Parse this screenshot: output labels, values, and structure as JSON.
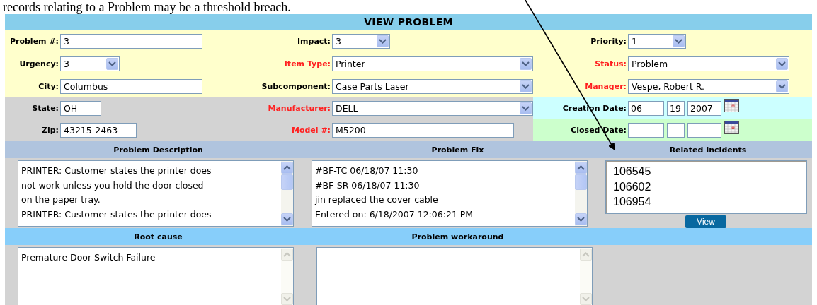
{
  "caption": "records relating to a Problem may be a threshold breach.",
  "title": "VIEW PROBLEM",
  "field_rows": [
    [
      {
        "label": "Problem #:",
        "required": false,
        "kind": "text",
        "value": "3"
      },
      {
        "label": "Impact:",
        "required": false,
        "kind": "select",
        "value": "3"
      },
      {
        "label": "Priority:",
        "required": false,
        "kind": "select",
        "value": "1"
      }
    ],
    [
      {
        "label": "Urgency:",
        "required": false,
        "kind": "select",
        "value": "3"
      },
      {
        "label": "Item Type:",
        "required": true,
        "kind": "select",
        "value": "Printer"
      },
      {
        "label": "Status:",
        "required": true,
        "kind": "select",
        "value": "Problem"
      }
    ],
    [
      {
        "label": "City:",
        "required": false,
        "kind": "text",
        "value": "Columbus"
      },
      {
        "label": "Subcomponent:",
        "required": false,
        "kind": "select",
        "value": "Case Parts Laser"
      },
      {
        "label": "Manager:",
        "required": true,
        "kind": "select",
        "value": "Vespe, Robert R."
      }
    ],
    [
      {
        "label": "State:",
        "required": false,
        "kind": "text",
        "value": "OH"
      },
      {
        "label": "Manufacturer:",
        "required": true,
        "kind": "select",
        "value": "DELL"
      },
      {
        "label": "Creation Date:",
        "required": false,
        "kind": "date",
        "parts": [
          "06",
          "19",
          "2007"
        ]
      }
    ],
    [
      {
        "label": "Zip:",
        "required": false,
        "kind": "text",
        "value": "43215-2463"
      },
      {
        "label": "Model #:",
        "required": true,
        "kind": "text",
        "value": "M5200"
      },
      {
        "label": "Closed Date:",
        "required": false,
        "kind": "date"
      }
    ]
  ],
  "section_rows": [
    [
      {
        "heading": "Problem Description",
        "kind": "textarea",
        "scrollbar_disabled": false,
        "lines": [
          "PRINTER: Customer states the printer does",
          "not work unless you hold the door closed",
          "on the paper tray.",
          "PRINTER: Customer states the printer does"
        ]
      },
      {
        "heading": "Problem Fix",
        "kind": "textarea",
        "scrollbar_disabled": false,
        "lines": [
          "#BF-TC 06/18/07 11:30",
          "#BF-SR 06/18/07 11:30",
          "jin replaced the cover cable",
          "Entered on: 6/18/2007 12:06:21 PM"
        ]
      },
      {
        "heading": "Related Incidents",
        "kind": "listbox",
        "items": [
          "106545",
          "106602",
          "106954"
        ],
        "button": "View"
      }
    ],
    [
      {
        "heading": "Root cause",
        "kind": "textarea",
        "scrollbar_disabled": true,
        "lines": [
          "Premature Door Switch Failure"
        ]
      },
      {
        "heading": "Problem workaround",
        "kind": "textarea",
        "scrollbar_disabled": true
      }
    ]
  ]
}
